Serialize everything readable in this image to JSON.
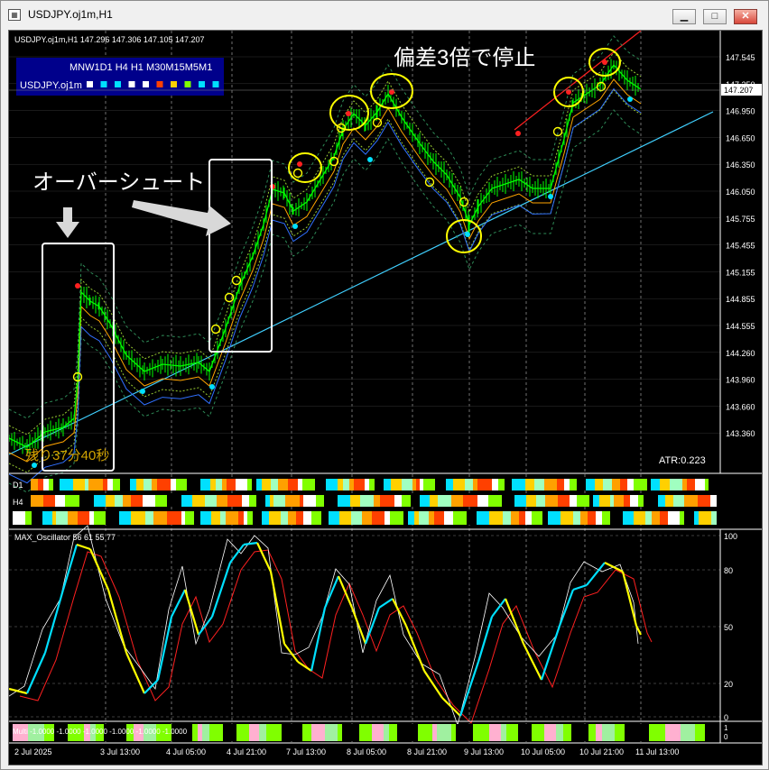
{
  "window": {
    "title": "USDJPY.oj1m,H1",
    "icon": "chart-window-icon",
    "buttons": {
      "minimize": "▁",
      "maximize": "□",
      "close": "✕"
    }
  },
  "chart": {
    "header": "USDJPY.oj1m,H1  147.296 147.306 147.105 147.207",
    "timeframe_panel_title": "MNW1D1 H4 H1 M30M15M5M1",
    "timeframe_panel_symbol": "USDJPY.oj1m",
    "current_price": "147.207",
    "atr": "ATR:0.223",
    "countdown": "残り37分40秒",
    "annotations": {
      "overshoot": "オーバーシュート",
      "stop": "偏差3倍で停止"
    },
    "price_axis": [
      "147.545",
      "147.250",
      "146.950",
      "146.650",
      "146.350",
      "146.050",
      "145.755",
      "145.455",
      "145.155",
      "144.855",
      "144.555",
      "144.260",
      "143.960",
      "143.660",
      "143.360"
    ],
    "time_axis": [
      "2 Jul 2025",
      "3 Jul 13:00",
      "4 Jul 05:00",
      "4 Jul 21:00",
      "7 Jul 13:00",
      "8 Jul 05:00",
      "8 Jul 21:00",
      "9 Jul 13:00",
      "10 Jul 05:00",
      "10 Jul 21:00",
      "11 Jul 13:00"
    ],
    "bar_labels": {
      "d1": "D1",
      "h4": "H4"
    },
    "oscillator": {
      "title": "MAX_Oscillator 56 61 55 77",
      "levels": [
        "100",
        "80",
        "50",
        "20",
        "0"
      ]
    },
    "multi": {
      "label": "Multi -1.0000 -1.0000 -1.0000 -1.0000 -1.0000 -1.0000",
      "levels": [
        "1",
        "0"
      ]
    },
    "colors": {
      "candle": "#00ff00",
      "ma_upper": "#ff3030",
      "ma_lower": "#00c8ff",
      "trend": "#40d0ff",
      "circle": "#ffff00"
    }
  }
}
